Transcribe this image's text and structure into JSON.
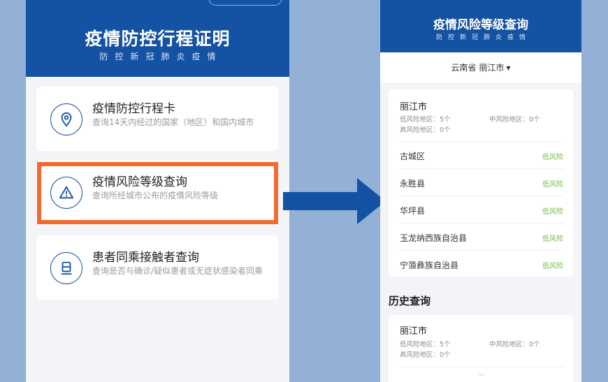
{
  "left": {
    "title": "疫情防控行程证明",
    "subtitle": "防控新冠肺炎疫情",
    "cards": [
      {
        "title": "疫情防控行程卡",
        "desc": "查询14天内经过的国家（地区）和国内城市",
        "icon": "location-pin-icon"
      },
      {
        "title": "疫情风险等级查询",
        "desc": "查询所经城市公布的疫情风险等级",
        "icon": "warning-triangle-icon"
      },
      {
        "title": "患者同乘接触者查询",
        "desc": "查询是否与确诊/疑似患者或无症状感染者同乘",
        "icon": "train-icon"
      }
    ]
  },
  "right": {
    "title": "疫情风险等级查询",
    "subtitle": "防控新冠肺炎疫情",
    "location": "云南省 丽江市",
    "summary": {
      "city": "丽江市",
      "low_label": "低风险地区：5个",
      "mid_label": "中风险地区：0个",
      "high_label": "高风险地区：0个"
    },
    "districts": [
      {
        "name": "古城区",
        "level": "低风险"
      },
      {
        "name": "永胜县",
        "level": "低风险"
      },
      {
        "name": "华坪县",
        "level": "低风险"
      },
      {
        "name": "玉龙纳西族自治县",
        "level": "低风险"
      },
      {
        "name": "宁蒗彝族自治县",
        "level": "低风险"
      }
    ],
    "history_title": "历史查询",
    "history": {
      "city": "丽江市",
      "low_label": "低风险地区：5个",
      "mid_label": "中风险地区：0个",
      "high_label": "高风险地区：0个"
    }
  },
  "colors": {
    "brand_blue": "#1452a3",
    "highlight_orange": "#f26a2d",
    "low_risk_green": "#6fbf3c",
    "background": "#93b0d6"
  }
}
